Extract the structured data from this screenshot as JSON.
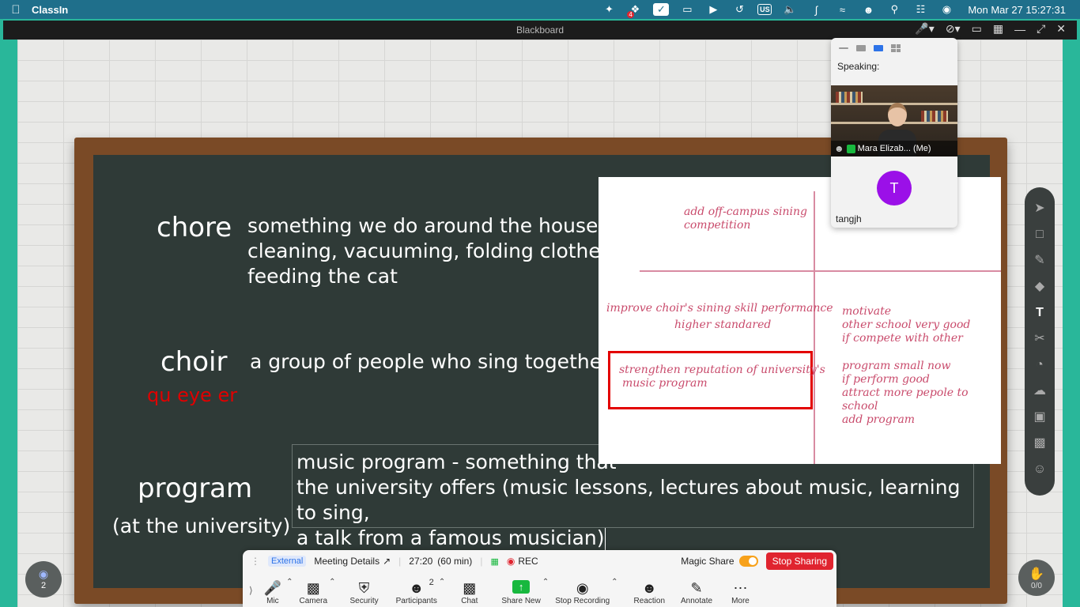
{
  "menubar": {
    "app_name": "ClassIn",
    "badge_count": "4",
    "input_source": "US",
    "datetime": "Mon Mar 27  15:27:31"
  },
  "window": {
    "title": "Blackboard"
  },
  "board": {
    "term1": "chore",
    "def1_line1": "something we do around the house",
    "def1_line2": "cleaning, vacuuming, folding clothes",
    "def1_line3": "feeding the cat",
    "term2": "choir",
    "pronunciation": "qu eye er",
    "def2": "a group of people who sing together",
    "term3": "program",
    "term3_sub": "(at the university)",
    "textbox_line1": "music program - something that",
    "textbox_line2": "the university offers (music lessons, lectures about music, learning to sing,",
    "textbox_line3": "a talk from a famous musician)"
  },
  "notes": {
    "n1_line1": "add off-campus sining",
    "n1_line2": "competition",
    "n2_line1": "improve choir's sining skill performance",
    "n2_line2": "higher standared",
    "n3_line1": "strengthen  reputation of university's",
    "n3_line2": "music program",
    "n4_line1": "motivate",
    "n4_line2": "other school very good",
    "n4_line3": "if compete with other",
    "n5_line1": "program small now",
    "n5_line2": "if perform good",
    "n5_line3": "attract more pepole to school",
    "n5_line4": "add program"
  },
  "video_panel": {
    "speaking_label": "Speaking:",
    "self_name": "Mara Elizab... (Me)",
    "other_initial": "T",
    "other_name": "tangjh"
  },
  "left_circle_count": "2",
  "right_circle_label": "0/0",
  "zoom_bar": {
    "external_tag": "External",
    "meeting_details": "Meeting Details",
    "timer": "27:20",
    "duration": "(60 min)",
    "rec": "REC",
    "magic_share": "Magic Share",
    "stop_sharing": "Stop Sharing",
    "participants_count": "2",
    "buttons": {
      "mic": "Mic",
      "camera": "Camera",
      "security": "Security",
      "participants": "Participants",
      "chat": "Chat",
      "share_new": "Share New",
      "stop_recording": "Stop Recording",
      "reaction": "Reaction",
      "annotate": "Annotate",
      "more": "More"
    }
  }
}
